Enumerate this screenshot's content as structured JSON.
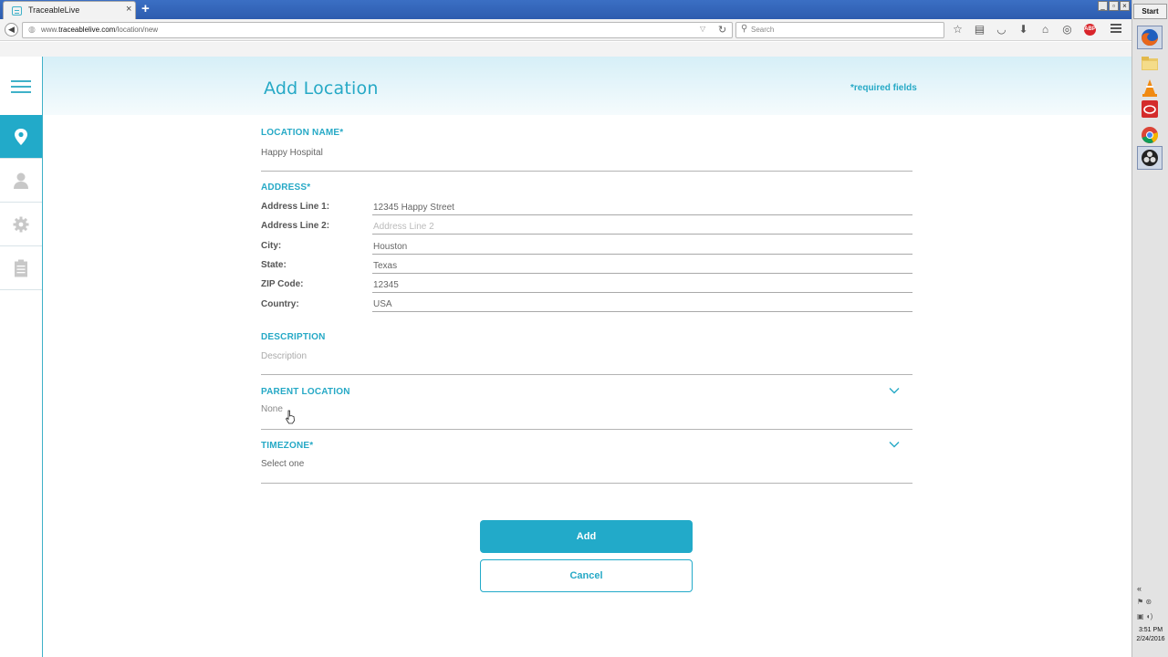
{
  "browser": {
    "tab_title": "TraceableLive",
    "tab_close": "×",
    "new_tab": "+",
    "url_prefix": "www.",
    "url_domain": "traceablelive.com",
    "url_path": "/location/new",
    "search_placeholder": "Search"
  },
  "window_controls": [
    "_",
    "▫",
    "×"
  ],
  "header": {
    "title": "Add Location",
    "required_note": "*required fields"
  },
  "sidebar": {
    "items": [
      {
        "name": "location",
        "icon": "location-pin-icon",
        "active": true
      },
      {
        "name": "user",
        "icon": "user-icon",
        "active": false
      },
      {
        "name": "settings",
        "icon": "gear-icon",
        "active": false
      },
      {
        "name": "reports",
        "icon": "clipboard-icon",
        "active": false
      }
    ],
    "accent": "#22aac9"
  },
  "form": {
    "location_name": {
      "label": "LOCATION NAME*",
      "value": "Happy Hospital"
    },
    "address": {
      "label": "ADDRESS*",
      "fields": [
        {
          "label": "Address Line 1:",
          "value": "12345 Happy Street",
          "placeholder": ""
        },
        {
          "label": "Address Line 2:",
          "value": "",
          "placeholder": "Address Line 2"
        },
        {
          "label": "City:",
          "value": "Houston",
          "placeholder": ""
        },
        {
          "label": "State:",
          "value": "Texas",
          "placeholder": ""
        },
        {
          "label": "ZIP Code:",
          "value": "12345",
          "placeholder": ""
        },
        {
          "label": "Country:",
          "value": "USA",
          "placeholder": ""
        }
      ]
    },
    "description": {
      "label": "DESCRIPTION",
      "placeholder": "Description"
    },
    "parent_location": {
      "label": "PARENT LOCATION",
      "value": "None"
    },
    "timezone": {
      "label": "TIMEZONE*",
      "value": "Select one"
    }
  },
  "buttons": {
    "add": "Add",
    "cancel": "Cancel"
  },
  "taskbar": {
    "start": "Start",
    "expand": "«",
    "time": "3:51 PM",
    "date": "2/24/2016"
  }
}
